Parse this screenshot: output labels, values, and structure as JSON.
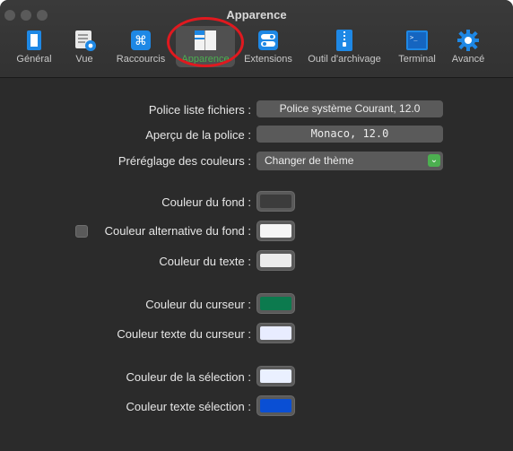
{
  "window": {
    "title": "Apparence"
  },
  "toolbar": {
    "tabs": [
      {
        "label": "Général",
        "icon": "general-panel-icon"
      },
      {
        "label": "Vue",
        "icon": "view-list-eye-icon"
      },
      {
        "label": "Raccourcis",
        "icon": "command-key-icon"
      },
      {
        "label": "Apparence",
        "icon": "appearance-panel-icon",
        "active": true
      },
      {
        "label": "Extensions",
        "icon": "toggle-switch-icon"
      },
      {
        "label": "Outil d'archivage",
        "icon": "zip-archive-icon"
      },
      {
        "label": "Terminal",
        "icon": "terminal-icon"
      },
      {
        "label": "Avancé",
        "icon": "gear-icon"
      }
    ]
  },
  "settings": {
    "font_list_label": "Police liste fichiers :",
    "font_list_value": "Police système Courant, 12.0",
    "font_preview_label": "Aperçu de la police :",
    "font_preview_value": "Monaco, 12.0",
    "color_preset_label": "Préréglage des couleurs :",
    "color_preset_value": "Changer de thème",
    "bg_color_label": "Couleur du fond :",
    "bg_color": "#3c3c3c",
    "alt_bg_color_label": "Couleur alternative du fond :",
    "alt_bg_color": "#f5f5f5",
    "alt_bg_checked": false,
    "text_color_label": "Couleur du texte :",
    "text_color": "#ececec",
    "cursor_color_label": "Couleur du curseur :",
    "cursor_color": "#0c7a4e",
    "cursor_text_color_label": "Couleur texte du curseur :",
    "cursor_text_color": "#e8ecff",
    "selection_color_label": "Couleur de la sélection :",
    "selection_color": "#eaf0ff",
    "selection_text_color_label": "Couleur texte sélection :",
    "selection_text_color": "#0a4fd4"
  },
  "colors": {
    "accent": "#4caf50",
    "highlight_ring": "#e0191f"
  }
}
